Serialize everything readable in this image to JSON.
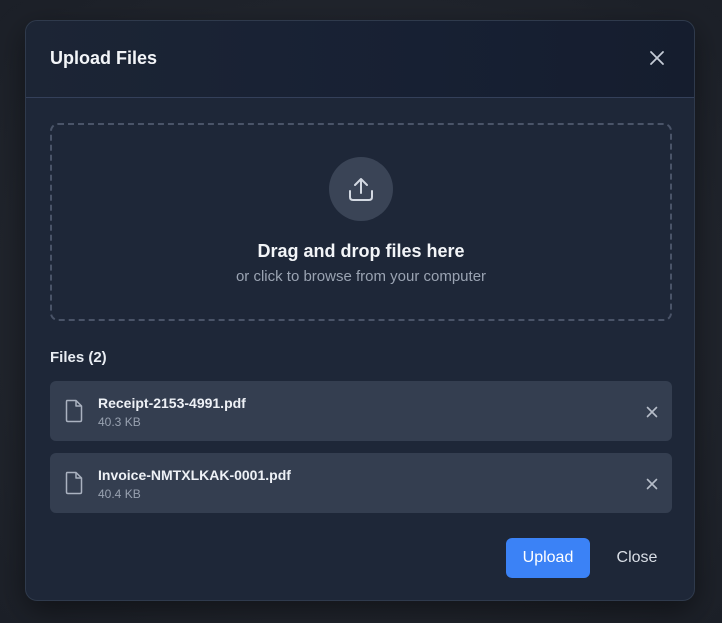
{
  "modal": {
    "title": "Upload Files",
    "close_icon": "close-icon"
  },
  "dropzone": {
    "icon": "upload-icon",
    "title": "Drag and drop files here",
    "subtitle": "or click to browse from your computer"
  },
  "files": {
    "heading": "Files (2)",
    "items": [
      {
        "name": "Receipt-2153-4991.pdf",
        "size": "40.3 KB",
        "icon": "file-icon"
      },
      {
        "name": "Invoice-NMTXLKAK-0001.pdf",
        "size": "40.4 KB",
        "icon": "file-icon"
      }
    ]
  },
  "footer": {
    "upload_label": "Upload",
    "close_label": "Close"
  },
  "colors": {
    "accent": "#3b82f6",
    "modal_bg": "#1e2738",
    "file_item_bg": "#343e50"
  }
}
